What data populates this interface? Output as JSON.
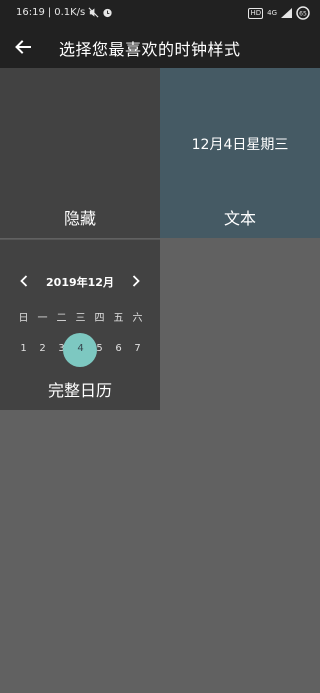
{
  "status_bar": {
    "time": "16:19",
    "separator": "|",
    "speed": "0.1K/s",
    "hd": "HD",
    "network": "4G",
    "battery": "65"
  },
  "toolbar": {
    "title": "选择您最喜欢的时钟样式"
  },
  "styles": {
    "hidden": {
      "label": "隐藏"
    },
    "text": {
      "label": "文本",
      "date": "12月4日星期三"
    },
    "calendar": {
      "label": "完整日历",
      "month": "2019年12月",
      "weekdays": [
        "日",
        "一",
        "二",
        "三",
        "四",
        "五",
        "六"
      ],
      "days": [
        "1",
        "2",
        "3",
        "4",
        "5",
        "6",
        "7"
      ],
      "selected_day": "4"
    }
  },
  "colors": {
    "background": "#616161",
    "tile_dark": "#424242",
    "tile_text": "#455a64",
    "accent_teal": "#7dc8c1"
  }
}
